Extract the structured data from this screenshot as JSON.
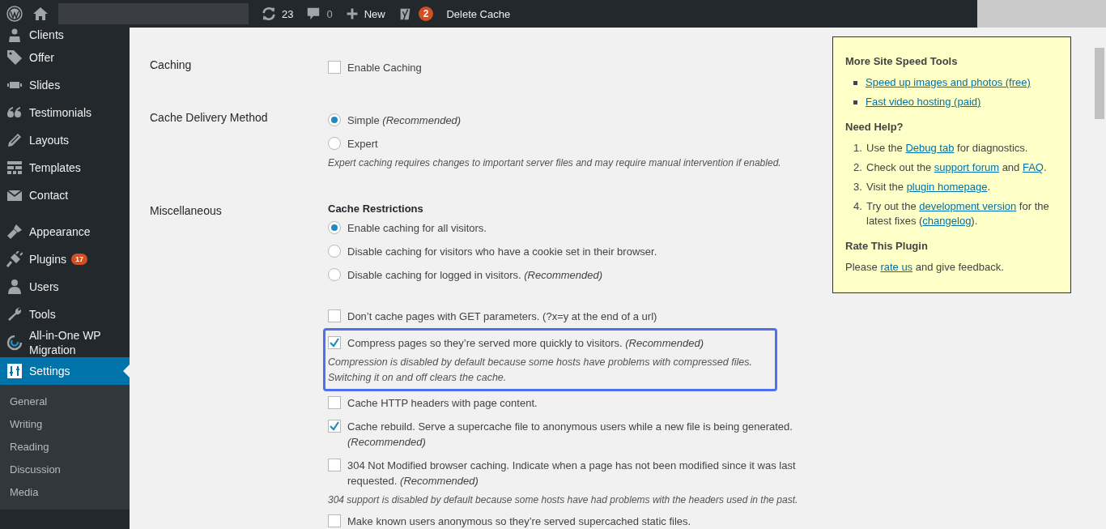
{
  "admin_bar": {
    "updates": "23",
    "comments": "0",
    "new": "New",
    "seo_badge": "2",
    "delete_cache": "Delete Cache"
  },
  "sidebar": {
    "groups": [
      {
        "items": [
          {
            "label": "Clients",
            "selected": false
          },
          {
            "label": "Offer",
            "selected": false
          },
          {
            "label": "Slides",
            "selected": false
          },
          {
            "label": "Testimonials",
            "selected": false
          },
          {
            "label": "Layouts",
            "selected": false
          },
          {
            "label": "Templates",
            "selected": false
          },
          {
            "label": "Contact",
            "selected": false
          }
        ]
      },
      {
        "items": [
          {
            "label": "Appearance",
            "selected": false
          },
          {
            "label": "Plugins",
            "selected": false,
            "badge": "17"
          },
          {
            "label": "Users",
            "selected": false
          },
          {
            "label": "Tools",
            "selected": false
          },
          {
            "label": "All-in-One WP Migration",
            "selected": false
          },
          {
            "label": "Settings",
            "selected": true
          }
        ]
      }
    ],
    "submenu": [
      {
        "label": "General"
      },
      {
        "label": "Writing"
      },
      {
        "label": "Reading"
      },
      {
        "label": "Discussion"
      },
      {
        "label": "Media"
      }
    ]
  },
  "settings": [
    {
      "label": "Caching",
      "items": [
        {
          "kind": "checkbox",
          "text": "Enable Caching",
          "checked": false,
          "highlighted": false
        }
      ]
    },
    {
      "label": "Cache Delivery Method",
      "items": [
        {
          "kind": "radio",
          "text": "Simple *(Recommended)*",
          "selected": true
        },
        {
          "kind": "radio",
          "text": "Expert",
          "selected": false
        },
        {
          "kind": "note",
          "text": "Expert caching requires changes to important server files and may require manual intervention if enabled."
        }
      ]
    },
    {
      "label": "Miscellaneous",
      "items": [
        {
          "kind": "heading",
          "text": "Cache Restrictions"
        },
        {
          "kind": "radio",
          "text": "Enable caching for all visitors.",
          "selected": true
        },
        {
          "kind": "radio",
          "text": "Disable caching for visitors who have a cookie set in their browser.",
          "selected": false
        },
        {
          "kind": "radio",
          "text": "Disable caching for logged in visitors. *(Recommended)*",
          "selected": false
        },
        {
          "kind": "checkbox",
          "text": "Don’t cache pages with GET parameters. (?x=y at the end of a url)",
          "checked": false,
          "highlighted": false
        },
        {
          "kind": "checkbox",
          "text": "Compress pages so they’re served more quickly to visitors. *(Recommended)*",
          "checked": true,
          "highlighted": true,
          "note": "Compression is disabled by default because some hosts have problems with compressed files. Switching it on and off clears the cache."
        },
        {
          "kind": "checkbox",
          "text": "Cache HTTP headers with page content.",
          "checked": false,
          "highlighted": false
        },
        {
          "kind": "checkbox",
          "text": "Cache rebuild. Serve a supercache file to anonymous users while a new file is being generated. *(Recommended)*",
          "checked": true,
          "highlighted": false
        },
        {
          "kind": "checkbox",
          "text": "304 Not Modified browser caching. Indicate when a page has not been modified since it was last requested. *(Recommended)*",
          "checked": false,
          "highlighted": false,
          "note": "304 support is disabled by default because some hosts have had problems with the headers used in the past."
        },
        {
          "kind": "checkbox",
          "text": "Make known users anonymous so they’re served supercached static files.",
          "checked": false,
          "highlighted": false
        }
      ]
    }
  ],
  "aside": {
    "sections": [
      {
        "title": "More Site Speed Tools",
        "kind": "bullets",
        "items": [
          {
            "parts": [
              {
                "text": "Speed up images and photos (free)",
                "link": true
              }
            ]
          },
          {
            "parts": [
              {
                "text": "Fast video hosting (paid)",
                "link": true
              }
            ]
          }
        ]
      },
      {
        "title": "Need Help?",
        "kind": "numbered",
        "items": [
          {
            "number": "1.",
            "parts": [
              {
                "text": "Use the ",
                "link": false
              },
              {
                "text": "Debug tab",
                "link": true
              },
              {
                "text": " for diagnostics.",
                "link": false
              }
            ]
          },
          {
            "number": "2.",
            "parts": [
              {
                "text": "Check out the ",
                "link": false
              },
              {
                "text": "support forum",
                "link": true
              },
              {
                "text": " and ",
                "link": false
              },
              {
                "text": "FAQ",
                "link": true
              },
              {
                "text": ".",
                "link": false
              }
            ]
          },
          {
            "number": "3.",
            "parts": [
              {
                "text": "Visit the ",
                "link": false
              },
              {
                "text": "plugin homepage",
                "link": true
              },
              {
                "text": ".",
                "link": false
              }
            ]
          },
          {
            "number": "4.",
            "parts": [
              {
                "text": "Try out the ",
                "link": false
              },
              {
                "text": "development version",
                "link": true
              },
              {
                "text": " for the latest fixes (",
                "link": false
              },
              {
                "text": "changelog",
                "link": true
              },
              {
                "text": ").",
                "link": false
              }
            ]
          }
        ]
      },
      {
        "title": "Rate This Plugin",
        "kind": "paragraph",
        "items": [
          {
            "parts": [
              {
                "text": "Please ",
                "link": false
              },
              {
                "text": "rate us",
                "link": true
              },
              {
                "text": " and give feedback.",
                "link": false
              }
            ]
          }
        ]
      }
    ]
  }
}
